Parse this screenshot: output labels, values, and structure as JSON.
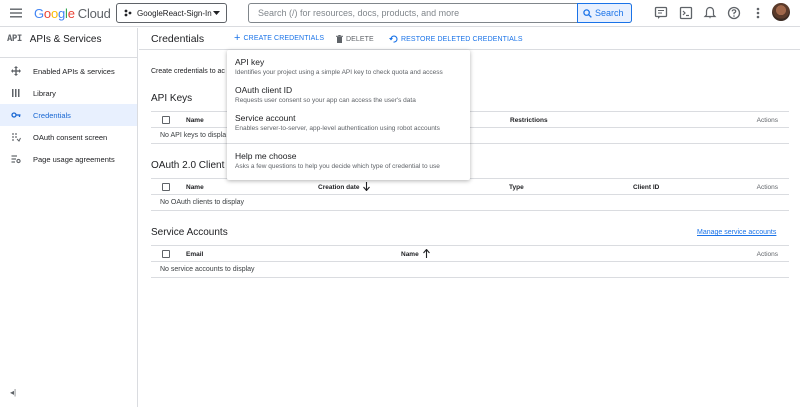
{
  "topbar": {
    "logo_google": "Google",
    "logo_cloud": "Cloud",
    "project_name": "GoogleReact-Sign-In",
    "search_placeholder": "Search (/) for resources, docs, products, and more",
    "search_button": "Search"
  },
  "sidebar": {
    "title_prefix": "API",
    "title": "APIs & Services",
    "items": [
      {
        "label": "Enabled APIs & services",
        "icon": "move-icon"
      },
      {
        "label": "Library",
        "icon": "library-icon"
      },
      {
        "label": "Credentials",
        "icon": "key-icon",
        "active": true
      },
      {
        "label": "OAuth consent screen",
        "icon": "consent-icon"
      },
      {
        "label": "Page usage agreements",
        "icon": "settings-list-icon"
      }
    ],
    "collapse": "◂|"
  },
  "main": {
    "title": "Credentials",
    "actions": {
      "create": "CREATE CREDENTIALS",
      "delete": "DELETE",
      "restore": "RESTORE DELETED CREDENTIALS"
    },
    "intro": "Create credentials to ac",
    "api_keys": {
      "title": "API Keys",
      "columns": [
        "Name",
        "Restrictions",
        "Actions"
      ],
      "empty": "No API keys to displa"
    },
    "oauth": {
      "title": "OAuth 2.0 Client I",
      "columns": [
        "Name",
        "Creation date",
        "Type",
        "Client ID",
        "Actions"
      ],
      "empty": "No OAuth clients to display"
    },
    "service_accounts": {
      "title": "Service Accounts",
      "manage_link": "Manage service accounts",
      "columns": [
        "Email",
        "Name",
        "Actions"
      ],
      "empty": "No service accounts to display"
    }
  },
  "dropdown": {
    "items": [
      {
        "title": "API key",
        "desc": "Identifies your project using a simple API key to check quota and access"
      },
      {
        "title": "OAuth client ID",
        "desc": "Requests user consent so your app can access the user's data"
      },
      {
        "title": "Service account",
        "desc": "Enables server-to-server, app-level authentication using robot accounts"
      },
      {
        "title": "Help me choose",
        "desc": "Asks a few questions to help you decide which type of credential to use"
      }
    ]
  },
  "colors": {
    "accent": "#1a73e8",
    "active_bg": "#e8f0fe",
    "border": "#dadce0"
  }
}
